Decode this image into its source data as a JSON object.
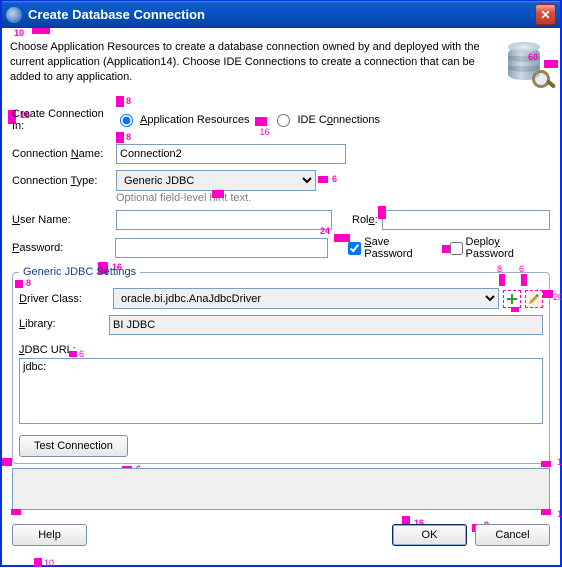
{
  "title": "Create Database Connection",
  "intro": "Choose Application Resources to create a database connection owned by and deployed with the current application (Application14). Choose IDE Connections to create a connection that can be added to any application.",
  "createInLabel": "Create Connection In:",
  "radio1": "Application Resources",
  "radio2": "IDE Connections",
  "connNameLabel": "Connection Name:",
  "connName": "Connection2",
  "connTypeLabel": "Connection Type:",
  "connType": "Generic JDBC",
  "hint": "Optional field-level  hint text.",
  "userLabel": "User Name:",
  "userValue": "",
  "roleLabel": "Role:",
  "roleValue": "",
  "passLabel": "Password:",
  "passValue": "",
  "savePass": "Save Password",
  "deployPass": "Deploy Password",
  "groupTitle": "Generic JDBC Settings",
  "driverLabel": "Driver Class:",
  "driverValue": "oracle.bi.jdbc.AnaJdbcDriver",
  "libLabel": "Library:",
  "libValue": "BI JDBC",
  "urlLabel": "JDBC URL:",
  "urlValue": "jdbc:",
  "testBtn": "Test Connection",
  "helpBtn": "Help",
  "okBtn": "OK",
  "cancelBtn": "Cancel",
  "gaps": {
    "g10": "10",
    "g16": "16",
    "g60": "60",
    "g8": "8",
    "g6": "6",
    "g24": "24",
    "g20": "20"
  }
}
